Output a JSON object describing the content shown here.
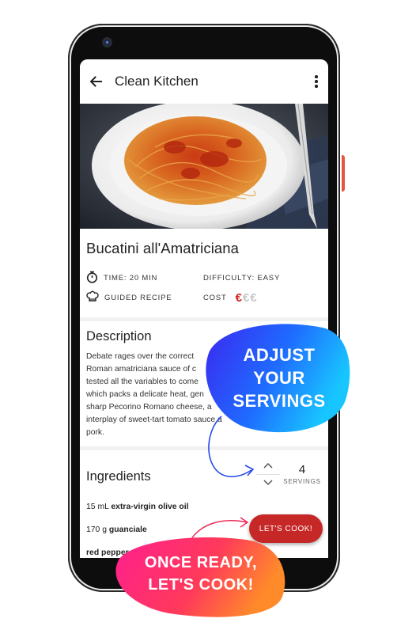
{
  "app": {
    "title": "Clean Kitchen"
  },
  "recipe": {
    "title": "Bucatini all'Amatriciana",
    "time_label": "TIME: 20 MIN",
    "difficulty_label": "DIFFICULTY: EASY",
    "guided_label": "GUIDED RECIPE",
    "cost_label": "COST",
    "cost_level": 1,
    "cost_max": 3,
    "cost_symbol": "€"
  },
  "description": {
    "title": "Description",
    "lines": [
      "Debate rages over the correct",
      "Roman amatriciana sauce of c",
      "tested all the variables to come",
      "which packs a delicate heat, gen",
      "sharp Pecorino Romano cheese, a",
      "interplay of sweet-tart tomato sauce a",
      "pork."
    ]
  },
  "ingredients": {
    "title": "Ingredients",
    "servings_count": "4",
    "servings_label": "SERVINGS",
    "items": [
      {
        "qty": "15 mL ",
        "name": "extra-virgin olive oil"
      },
      {
        "qty": "170 g ",
        "name": "guanciale"
      },
      {
        "qty": "",
        "name": "red pepper"
      }
    ]
  },
  "fab": {
    "label": "LET'S COOK!"
  },
  "promo": {
    "adjust_lines": [
      "ADJUST",
      "YOUR",
      "SERVINGS"
    ],
    "cook_lines": [
      "ONCE READY,",
      "LET'S COOK!"
    ]
  },
  "colors": {
    "accent_red": "#c62828",
    "euro_active": "#d32121",
    "phone_button": "#e8553f"
  }
}
